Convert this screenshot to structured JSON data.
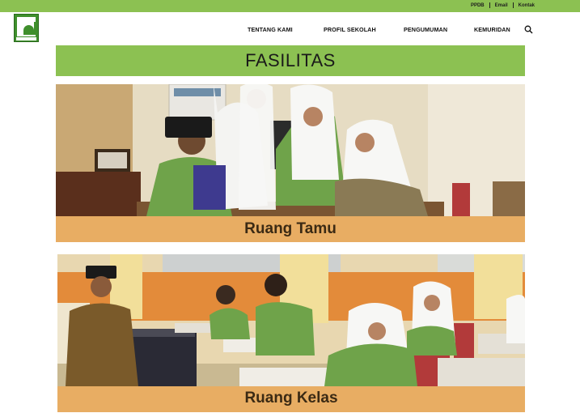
{
  "topbar": {
    "links": [
      "PPDB",
      "Email",
      "Kontak"
    ]
  },
  "nav": {
    "items": [
      "TENTANG KAMI",
      "PROFIL SEKOLAH",
      "PENGUMUMAN",
      "KEMURIDAN"
    ]
  },
  "icons": {
    "search": "search-icon",
    "logo": "school-logo"
  },
  "page": {
    "title": "FASILITAS"
  },
  "facilities": [
    {
      "caption": "Ruang Tamu"
    },
    {
      "caption": "Ruang Kelas"
    }
  ],
  "colors": {
    "accent": "#8cc152",
    "caption_bg": "#e8ad63"
  }
}
